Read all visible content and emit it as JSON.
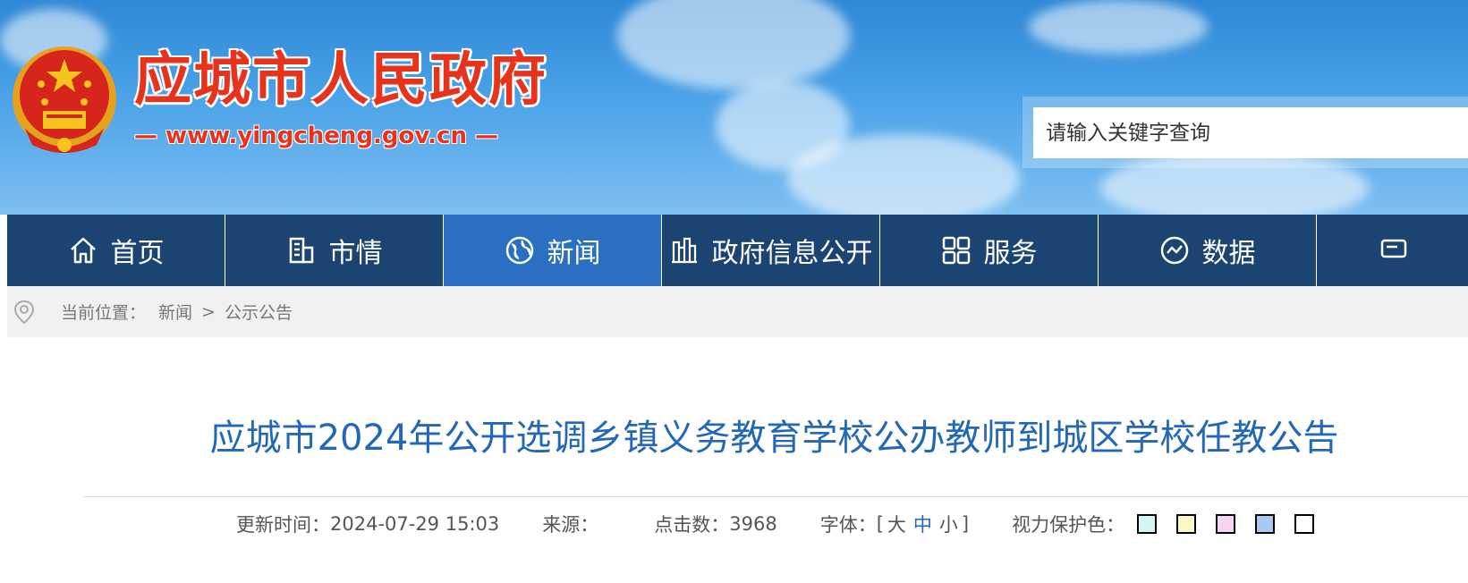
{
  "header": {
    "site_name": "应城市人民政府",
    "site_domain": "— www.yingcheng.gov.cn —",
    "emblem_icon": "national-emblem-icon"
  },
  "search": {
    "placeholder": "请输入关键字查询"
  },
  "nav": {
    "items": [
      {
        "label": "首页",
        "icon": "home-icon"
      },
      {
        "label": "市情",
        "icon": "building-icon"
      },
      {
        "label": "新闻",
        "icon": "globe-icon",
        "active": true
      },
      {
        "label": "政府信息公开",
        "icon": "city-icon"
      },
      {
        "label": "服务",
        "icon": "grid-icon"
      },
      {
        "label": "数据",
        "icon": "chart-circle-icon"
      }
    ]
  },
  "breadcrumb": {
    "prefix": "当前位置：",
    "items": [
      "新闻",
      "公示公告"
    ],
    "separator": ">"
  },
  "article": {
    "title": "应城市2024年公开选调乡镇义务教育学校公办教师到城区学校任教公告",
    "meta": {
      "update_label": "更新时间：",
      "update_value": "2024-07-29 15:03",
      "source_label": "来源：",
      "source_value": "",
      "clicks_label": "点击数：",
      "clicks_value": "3968",
      "font_label": "字体：",
      "font_open": "[",
      "font_large": "大",
      "font_medium": "中",
      "font_small": "小",
      "font_close": "]",
      "eye_label": "视力保护色："
    },
    "eye_colors": [
      "#d2f6f8",
      "#fdf7c8",
      "#f7d3f4",
      "#a9c9f1",
      "#ffffff"
    ]
  },
  "colors": {
    "nav_bg": "#1c4472",
    "nav_active": "#2a6fc2",
    "title": "#2367b8",
    "brand_red": "#e8331c"
  }
}
